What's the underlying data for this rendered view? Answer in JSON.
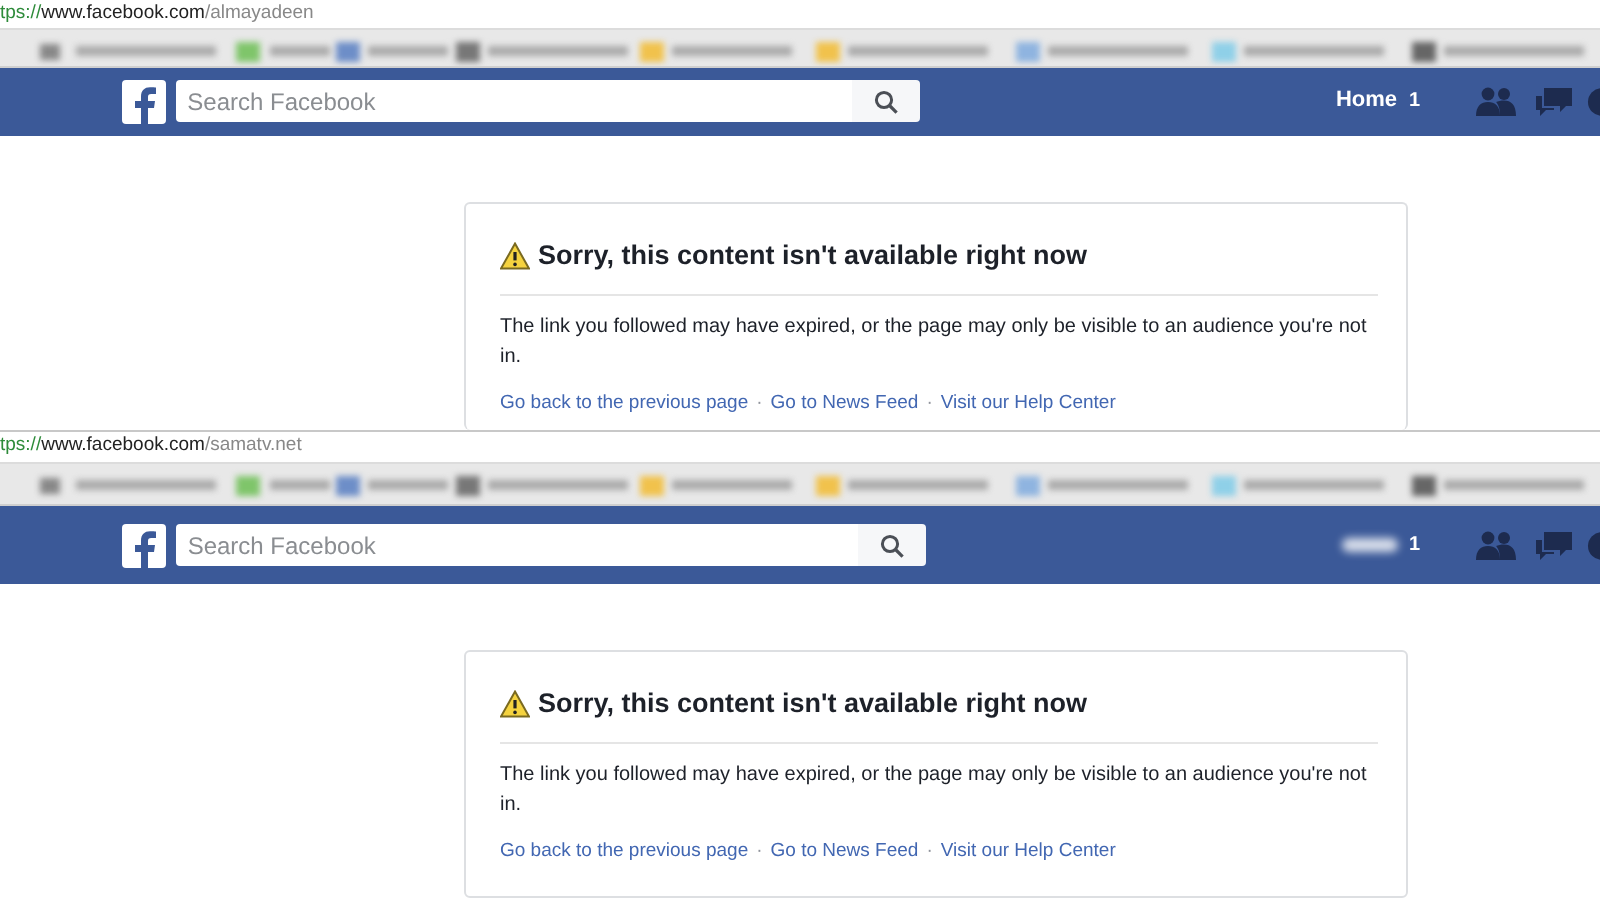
{
  "panels": [
    {
      "address_bar": {
        "scheme": "tps://",
        "host": "www.facebook.com",
        "path": "/almayadeen"
      },
      "nav": {
        "search": {
          "placeholder": "Search Facebook"
        },
        "home_label": "Home",
        "home_blurred": false,
        "home_badge": "1"
      },
      "card": {
        "title": "Sorry, this content isn't available right now",
        "message": "The link you followed may have expired, or the page may only be visible to an audience you're not in.",
        "links": [
          "Go back to the previous page",
          "Go to News Feed",
          "Visit our Help Center"
        ],
        "separator": "·",
        "cut_off": true
      }
    },
    {
      "address_bar": {
        "scheme": "tps://",
        "host": "www.facebook.com",
        "path": "/samatv.net"
      },
      "nav": {
        "search": {
          "placeholder": "Search Facebook"
        },
        "home_blurred": true,
        "home_badge": "1"
      },
      "card": {
        "title": "Sorry, this content isn't available right now",
        "message": "The link you followed may have expired, or the page may only be visible to an audience you're not in.",
        "links": [
          "Go back to the previous page",
          "Go to News Feed",
          "Visit our Help Center"
        ],
        "separator": "·",
        "cut_off": false
      }
    }
  ]
}
